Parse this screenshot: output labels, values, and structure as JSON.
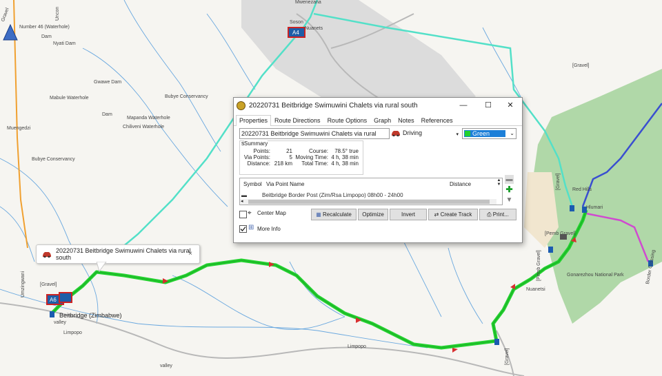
{
  "map": {
    "labels": {
      "mwenezana": "Mwenezana",
      "soson": "Soson",
      "nuanets": "Nuanets",
      "a4_top": "A4",
      "number46": "Number 46 (Waterhole)",
      "dam1": "Dam",
      "nyati_dam": "Nyati Dam",
      "gwawe_dam": "Gwawe Dam",
      "mabule_waterhole": "Mabule Waterhole",
      "bubye_conservancy_top": "Bubye Conservancy",
      "dam2": "Dam",
      "mapanda_waterhole": "Mapanda Waterhole",
      "chiliveni_waterhole": "Chiliveni Waterhole",
      "muengedzi": "Muengedzi",
      "bubye_conservancy": "Bubye Conservancy",
      "gravel_right": "[Gravel]",
      "gravel_vert": "[Gravel]",
      "red_hills": "Red Hills",
      "hlimari": "Hlumari",
      "pemba_gravel": "[Pemb Gravel]",
      "pemba_gravel2": "[Pemb Gravel]",
      "gonarezhou": "Gonarezhou National Park",
      "nuanetsi": "Nuanetsi",
      "border_crossing": "Border Crossing",
      "gravel_left": "[Gravel]",
      "umzingwani": "Umzingwani",
      "beitbridge": "Beitbridge (Zimbabwe)",
      "valley1": "valley",
      "limpopo1": "Limpopo",
      "limpopo2": "Limpopo",
      "gravel_bottom": "[Gravel]",
      "valley2": "valley",
      "a6": "A6",
      "ravel_top": "Gravel",
      "unconf": "Uncon"
    }
  },
  "tooltip": {
    "text": "20220731 Beitbridge Swimuwini Chalets via rural south",
    "close": "×"
  },
  "dialog": {
    "title": "20220731 Beitbridge Swimuwini Chalets via rural south",
    "minimize": "—",
    "maximize": "☐",
    "close": "✕",
    "tabs": [
      "Properties",
      "Route Directions",
      "Route Options",
      "Graph",
      "Notes",
      "References"
    ],
    "name_value": "20220731 Beitbridge Swimuwini Chalets via rural south",
    "mode_value": "Driving",
    "color_value": "Green",
    "summary": {
      "header": "Summary",
      "points_label": "Points:",
      "points_value": "21",
      "via_label": "Via Points:",
      "via_value": "5",
      "distance_label": "Distance:",
      "distance_value": "218 km",
      "course_label": "Course:",
      "course_value": "78.5° true",
      "moving_label": "Moving Time:",
      "moving_value": "4 h, 38 min",
      "total_label": "Total Time:",
      "total_value": "4 h, 38 min"
    },
    "grid": {
      "col_symbol": "Symbol",
      "col_via": "Via Point Name",
      "col_distance": "Distance",
      "row1": "Beitbridge Border Post (Zim/Rsa Limpopo) 08h00 - 24h00"
    },
    "center_map_label": "Center Map",
    "more_info_label": "More Info",
    "buttons": {
      "recalculate": "Recalculate",
      "optimize": "Optimize",
      "invert": "Invert",
      "create_track": "Create Track",
      "print": "Print..."
    }
  },
  "colors": {
    "route": "#22d12e",
    "park": "#a9d5a0",
    "track_cyan": "#53e0c8",
    "track_blue": "#3a4fd0",
    "track_magenta": "#d04ad0"
  }
}
